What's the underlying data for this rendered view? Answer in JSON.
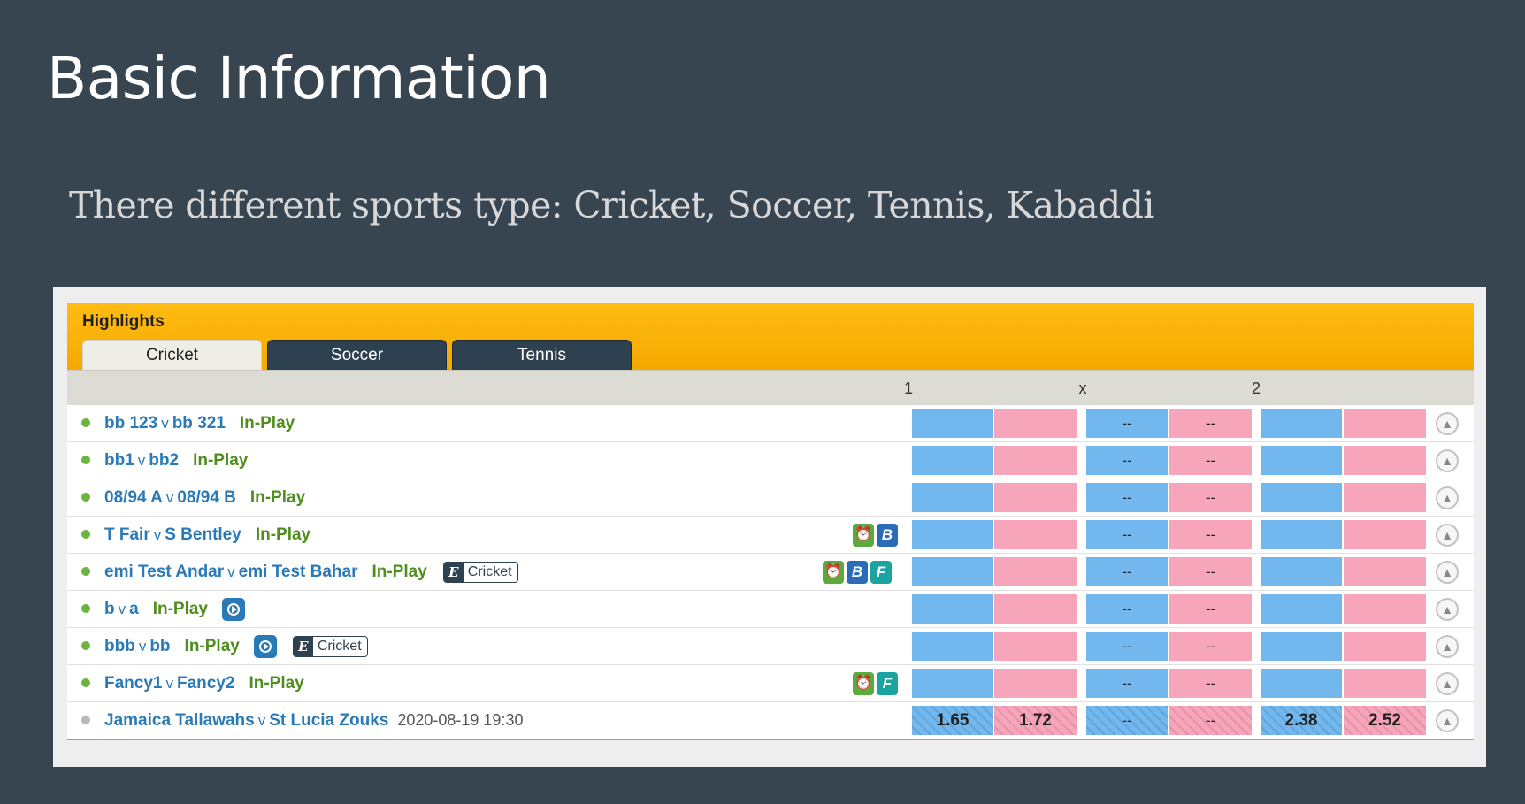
{
  "slide": {
    "title": "Basic Information",
    "subtitle": "There different sports type: Cricket, Soccer, Tennis, Kabaddi"
  },
  "highlights": {
    "title": "Highlights",
    "tabs": [
      "Cricket",
      "Soccer",
      "Tennis"
    ],
    "active_tab": "Cricket",
    "columns": [
      "1",
      "x",
      "2"
    ]
  },
  "icons": {
    "live_dot": "green-dot-icon",
    "clock": "⏰",
    "bookmaker": "B",
    "fancy": "F",
    "e_badge": "E",
    "pin": "pin-icon"
  },
  "colors": {
    "background": "#36454f",
    "accent": "#ffbc12",
    "back": "#72b8ee",
    "lay": "#f6a5bb",
    "in_play": "#4f8e1e",
    "link": "#2a7ab8"
  },
  "events": [
    {
      "home": "bb 123",
      "vs": "v",
      "away": "bb 321",
      "status": "In-Play",
      "live": true,
      "odds": [
        "",
        "",
        "--",
        "--",
        "",
        ""
      ]
    },
    {
      "home": "bb1",
      "vs": "v",
      "away": "bb2",
      "status": "In-Play",
      "live": true,
      "odds": [
        "",
        "",
        "--",
        "--",
        "",
        ""
      ]
    },
    {
      "home": "08/94 A",
      "vs": "v",
      "away": "08/94 B",
      "status": "In-Play",
      "live": true,
      "odds": [
        "",
        "",
        "--",
        "--",
        "",
        ""
      ]
    },
    {
      "home": "T Fair",
      "vs": "v",
      "away": "S Bentley",
      "status": "In-Play",
      "live": true,
      "odds": [
        "",
        "",
        "--",
        "--",
        "",
        ""
      ]
    },
    {
      "home": "emi Test Andar",
      "vs": "v",
      "away": "emi Test Bahar",
      "status": "In-Play",
      "live": true,
      "badge": "Cricket",
      "odds": [
        "",
        "",
        "--",
        "--",
        "",
        ""
      ]
    },
    {
      "home": "b",
      "vs": "v",
      "away": "a",
      "status": "In-Play",
      "live": true,
      "odds": [
        "",
        "",
        "--",
        "--",
        "",
        ""
      ]
    },
    {
      "home": "bbb",
      "vs": "v",
      "away": "bb",
      "status": "In-Play",
      "live": true,
      "badge": "Cricket",
      "odds": [
        "",
        "",
        "--",
        "--",
        "",
        ""
      ]
    },
    {
      "home": "Fancy1",
      "vs": "v",
      "away": "Fancy2",
      "status": "In-Play",
      "live": true,
      "odds": [
        "",
        "",
        "--",
        "--",
        "",
        ""
      ]
    },
    {
      "home": "Jamaica Tallawahs",
      "vs": "v",
      "away": "St Lucia Zouks",
      "date": "2020-08-19 19:30",
      "live": false,
      "odds": [
        "1.65",
        "1.72",
        "--",
        "--",
        "2.38",
        "2.52"
      ]
    }
  ]
}
